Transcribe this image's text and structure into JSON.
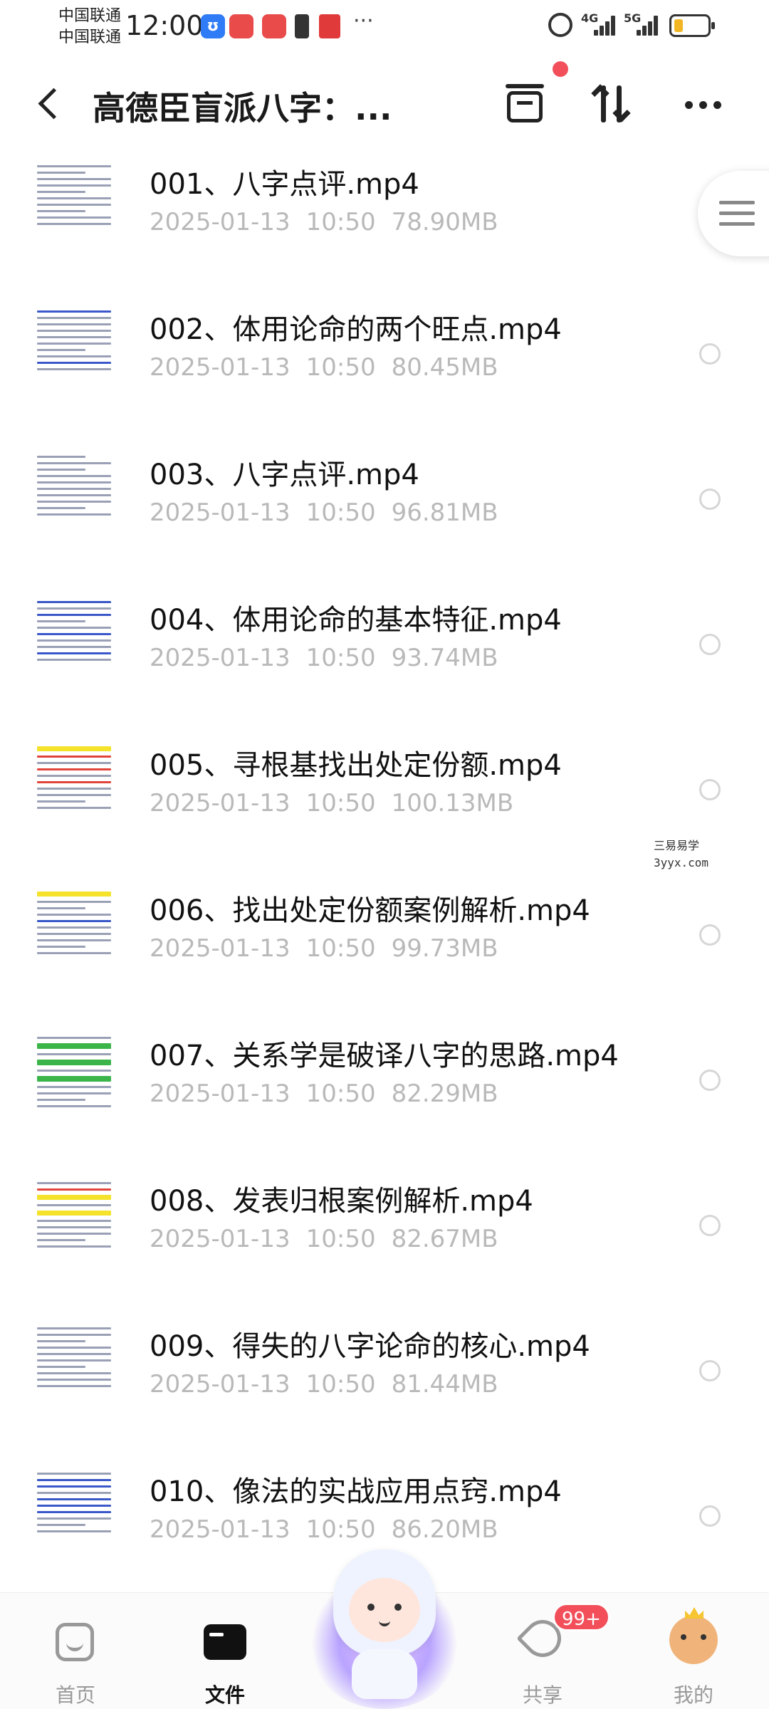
{
  "status_bar": {
    "carrier1": "中国联通",
    "carrier2": "中国联通",
    "time": "12:00",
    "net1": "4G",
    "net2": "5G",
    "more": "···"
  },
  "header": {
    "title": "高德臣盲派八字：...",
    "icons": [
      "back-icon",
      "select-icon",
      "sort-icon",
      "more-icon"
    ]
  },
  "files": [
    {
      "name": "001、八字点评.mp4",
      "date": "2025-01-13",
      "time": "10:50",
      "size": "78.90MB"
    },
    {
      "name": "002、体用论命的两个旺点.mp4",
      "date": "2025-01-13",
      "time": "10:50",
      "size": "80.45MB"
    },
    {
      "name": "003、八字点评.mp4",
      "date": "2025-01-13",
      "time": "10:50",
      "size": "96.81MB"
    },
    {
      "name": "004、体用论命的基本特征.mp4",
      "date": "2025-01-13",
      "time": "10:50",
      "size": "93.74MB"
    },
    {
      "name": "005、寻根基找出处定份额.mp4",
      "date": "2025-01-13",
      "time": "10:50",
      "size": "100.13MB"
    },
    {
      "name": "006、找出处定份额案例解析.mp4",
      "date": "2025-01-13",
      "time": "10:50",
      "size": "99.73MB"
    },
    {
      "name": "007、关系学是破译八字的思路.mp4",
      "date": "2025-01-13",
      "time": "10:50",
      "size": "82.29MB"
    },
    {
      "name": "008、发表归根案例解析.mp4",
      "date": "2025-01-13",
      "time": "10:50",
      "size": "82.67MB"
    },
    {
      "name": "009、得失的八字论命的核心.mp4",
      "date": "2025-01-13",
      "time": "10:50",
      "size": "81.44MB"
    },
    {
      "name": "010、像法的实战应用点窍.mp4",
      "date": "2025-01-13",
      "time": "10:50",
      "size": "86.20MB"
    }
  ],
  "watermark": {
    "line1": "三易易学",
    "line2": "3yyx.com"
  },
  "nav": {
    "home": "首页",
    "files": "文件",
    "share": "共享",
    "share_badge": "99+",
    "mine": "我的",
    "active": "files"
  },
  "colors": {
    "accent_red": "#f24f5b",
    "meta_gray": "#b9b9b9",
    "text": "#111111"
  }
}
